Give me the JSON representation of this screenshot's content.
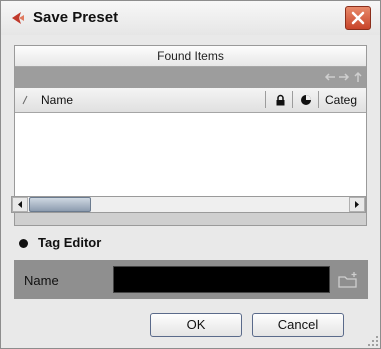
{
  "window": {
    "title": "Save Preset",
    "accent": "#c0392b"
  },
  "found_items": {
    "header": "Found Items"
  },
  "columns": {
    "name": "Name",
    "category": "Categ"
  },
  "tag_editor": {
    "label": "Tag Editor"
  },
  "name_field": {
    "label": "Name",
    "value": ""
  },
  "buttons": {
    "ok": "OK",
    "cancel": "Cancel"
  },
  "icons": [
    "app-icon",
    "close-icon",
    "back-arrow-icon",
    "forward-arrow-icon",
    "up-arrow-icon",
    "lock-icon",
    "pie-icon",
    "sort-indicator-icon",
    "scroll-left-icon",
    "scroll-right-icon",
    "folder-add-icon",
    "resize-grip-icon"
  ]
}
